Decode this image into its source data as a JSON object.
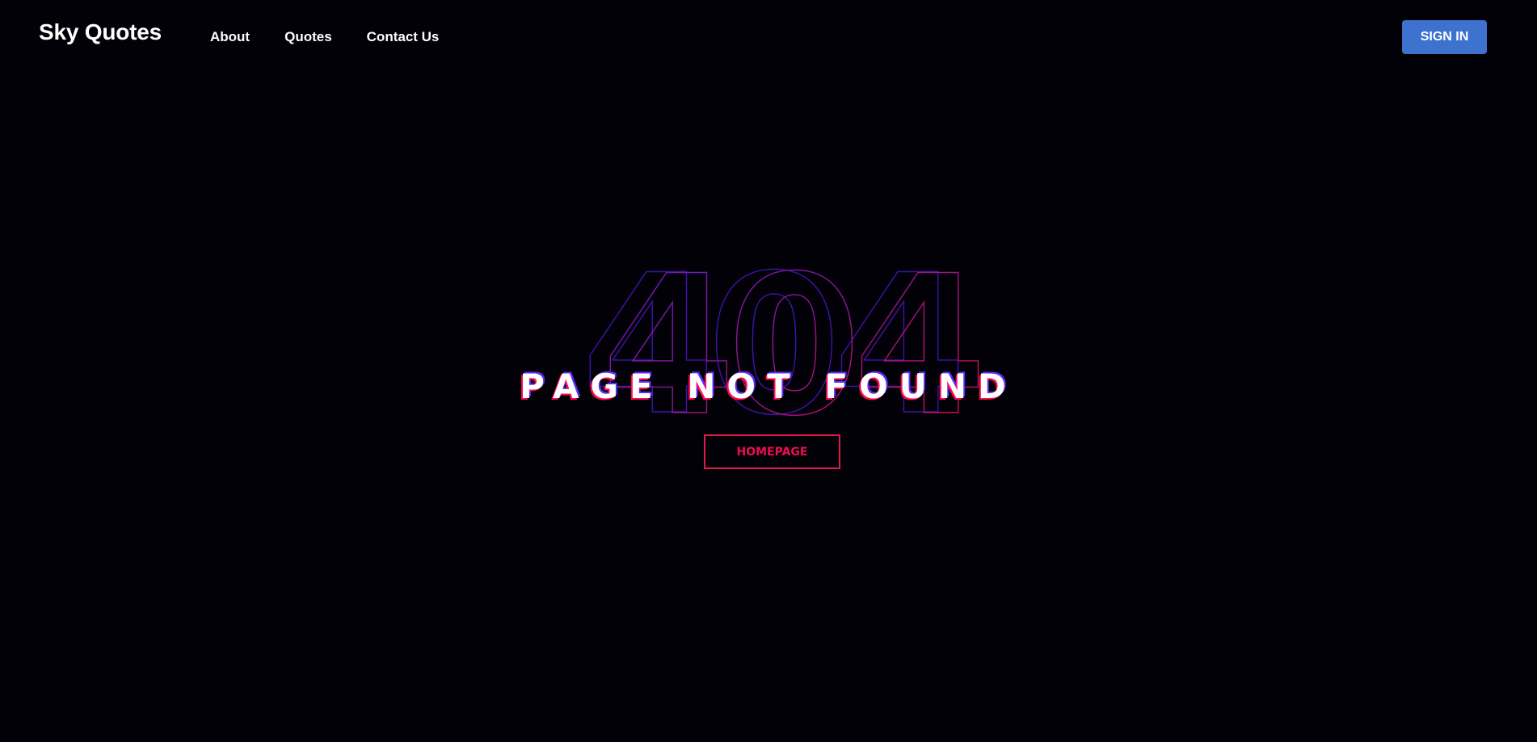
{
  "navbar": {
    "brand": "Sky Quotes",
    "links": [
      "About",
      "Quotes",
      "Contact Us"
    ],
    "signin_label": "SIGN IN"
  },
  "error": {
    "code": "404",
    "message": "PAGE NOT FOUND",
    "home_label": "HOMEPAGE"
  },
  "colors": {
    "background": "#030108",
    "accent_red": "#e1184e",
    "accent_purple": "#5a2bff",
    "button_blue": "#3d72cf"
  }
}
